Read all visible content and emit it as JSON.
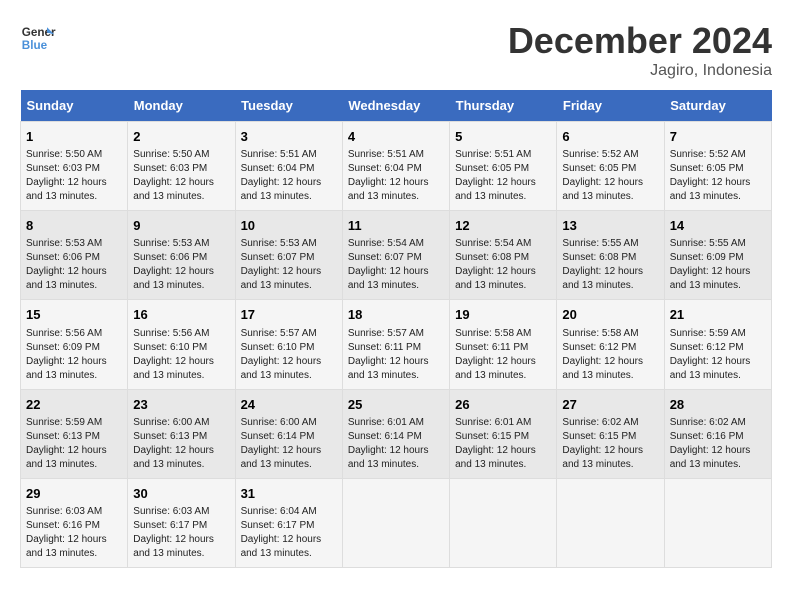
{
  "header": {
    "logo_line1": "General",
    "logo_line2": "Blue",
    "month_title": "December 2024",
    "location": "Jagiro, Indonesia"
  },
  "days_of_week": [
    "Sunday",
    "Monday",
    "Tuesday",
    "Wednesday",
    "Thursday",
    "Friday",
    "Saturday"
  ],
  "weeks": [
    [
      {
        "day": "1",
        "sunrise": "5:50 AM",
        "sunset": "6:03 PM",
        "daylight": "12 hours and 13 minutes."
      },
      {
        "day": "2",
        "sunrise": "5:50 AM",
        "sunset": "6:03 PM",
        "daylight": "12 hours and 13 minutes."
      },
      {
        "day": "3",
        "sunrise": "5:51 AM",
        "sunset": "6:04 PM",
        "daylight": "12 hours and 13 minutes."
      },
      {
        "day": "4",
        "sunrise": "5:51 AM",
        "sunset": "6:04 PM",
        "daylight": "12 hours and 13 minutes."
      },
      {
        "day": "5",
        "sunrise": "5:51 AM",
        "sunset": "6:05 PM",
        "daylight": "12 hours and 13 minutes."
      },
      {
        "day": "6",
        "sunrise": "5:52 AM",
        "sunset": "6:05 PM",
        "daylight": "12 hours and 13 minutes."
      },
      {
        "day": "7",
        "sunrise": "5:52 AM",
        "sunset": "6:05 PM",
        "daylight": "12 hours and 13 minutes."
      }
    ],
    [
      {
        "day": "8",
        "sunrise": "5:53 AM",
        "sunset": "6:06 PM",
        "daylight": "12 hours and 13 minutes."
      },
      {
        "day": "9",
        "sunrise": "5:53 AM",
        "sunset": "6:06 PM",
        "daylight": "12 hours and 13 minutes."
      },
      {
        "day": "10",
        "sunrise": "5:53 AM",
        "sunset": "6:07 PM",
        "daylight": "12 hours and 13 minutes."
      },
      {
        "day": "11",
        "sunrise": "5:54 AM",
        "sunset": "6:07 PM",
        "daylight": "12 hours and 13 minutes."
      },
      {
        "day": "12",
        "sunrise": "5:54 AM",
        "sunset": "6:08 PM",
        "daylight": "12 hours and 13 minutes."
      },
      {
        "day": "13",
        "sunrise": "5:55 AM",
        "sunset": "6:08 PM",
        "daylight": "12 hours and 13 minutes."
      },
      {
        "day": "14",
        "sunrise": "5:55 AM",
        "sunset": "6:09 PM",
        "daylight": "12 hours and 13 minutes."
      }
    ],
    [
      {
        "day": "15",
        "sunrise": "5:56 AM",
        "sunset": "6:09 PM",
        "daylight": "12 hours and 13 minutes."
      },
      {
        "day": "16",
        "sunrise": "5:56 AM",
        "sunset": "6:10 PM",
        "daylight": "12 hours and 13 minutes."
      },
      {
        "day": "17",
        "sunrise": "5:57 AM",
        "sunset": "6:10 PM",
        "daylight": "12 hours and 13 minutes."
      },
      {
        "day": "18",
        "sunrise": "5:57 AM",
        "sunset": "6:11 PM",
        "daylight": "12 hours and 13 minutes."
      },
      {
        "day": "19",
        "sunrise": "5:58 AM",
        "sunset": "6:11 PM",
        "daylight": "12 hours and 13 minutes."
      },
      {
        "day": "20",
        "sunrise": "5:58 AM",
        "sunset": "6:12 PM",
        "daylight": "12 hours and 13 minutes."
      },
      {
        "day": "21",
        "sunrise": "5:59 AM",
        "sunset": "6:12 PM",
        "daylight": "12 hours and 13 minutes."
      }
    ],
    [
      {
        "day": "22",
        "sunrise": "5:59 AM",
        "sunset": "6:13 PM",
        "daylight": "12 hours and 13 minutes."
      },
      {
        "day": "23",
        "sunrise": "6:00 AM",
        "sunset": "6:13 PM",
        "daylight": "12 hours and 13 minutes."
      },
      {
        "day": "24",
        "sunrise": "6:00 AM",
        "sunset": "6:14 PM",
        "daylight": "12 hours and 13 minutes."
      },
      {
        "day": "25",
        "sunrise": "6:01 AM",
        "sunset": "6:14 PM",
        "daylight": "12 hours and 13 minutes."
      },
      {
        "day": "26",
        "sunrise": "6:01 AM",
        "sunset": "6:15 PM",
        "daylight": "12 hours and 13 minutes."
      },
      {
        "day": "27",
        "sunrise": "6:02 AM",
        "sunset": "6:15 PM",
        "daylight": "12 hours and 13 minutes."
      },
      {
        "day": "28",
        "sunrise": "6:02 AM",
        "sunset": "6:16 PM",
        "daylight": "12 hours and 13 minutes."
      }
    ],
    [
      {
        "day": "29",
        "sunrise": "6:03 AM",
        "sunset": "6:16 PM",
        "daylight": "12 hours and 13 minutes."
      },
      {
        "day": "30",
        "sunrise": "6:03 AM",
        "sunset": "6:17 PM",
        "daylight": "12 hours and 13 minutes."
      },
      {
        "day": "31",
        "sunrise": "6:04 AM",
        "sunset": "6:17 PM",
        "daylight": "12 hours and 13 minutes."
      },
      null,
      null,
      null,
      null
    ]
  ]
}
